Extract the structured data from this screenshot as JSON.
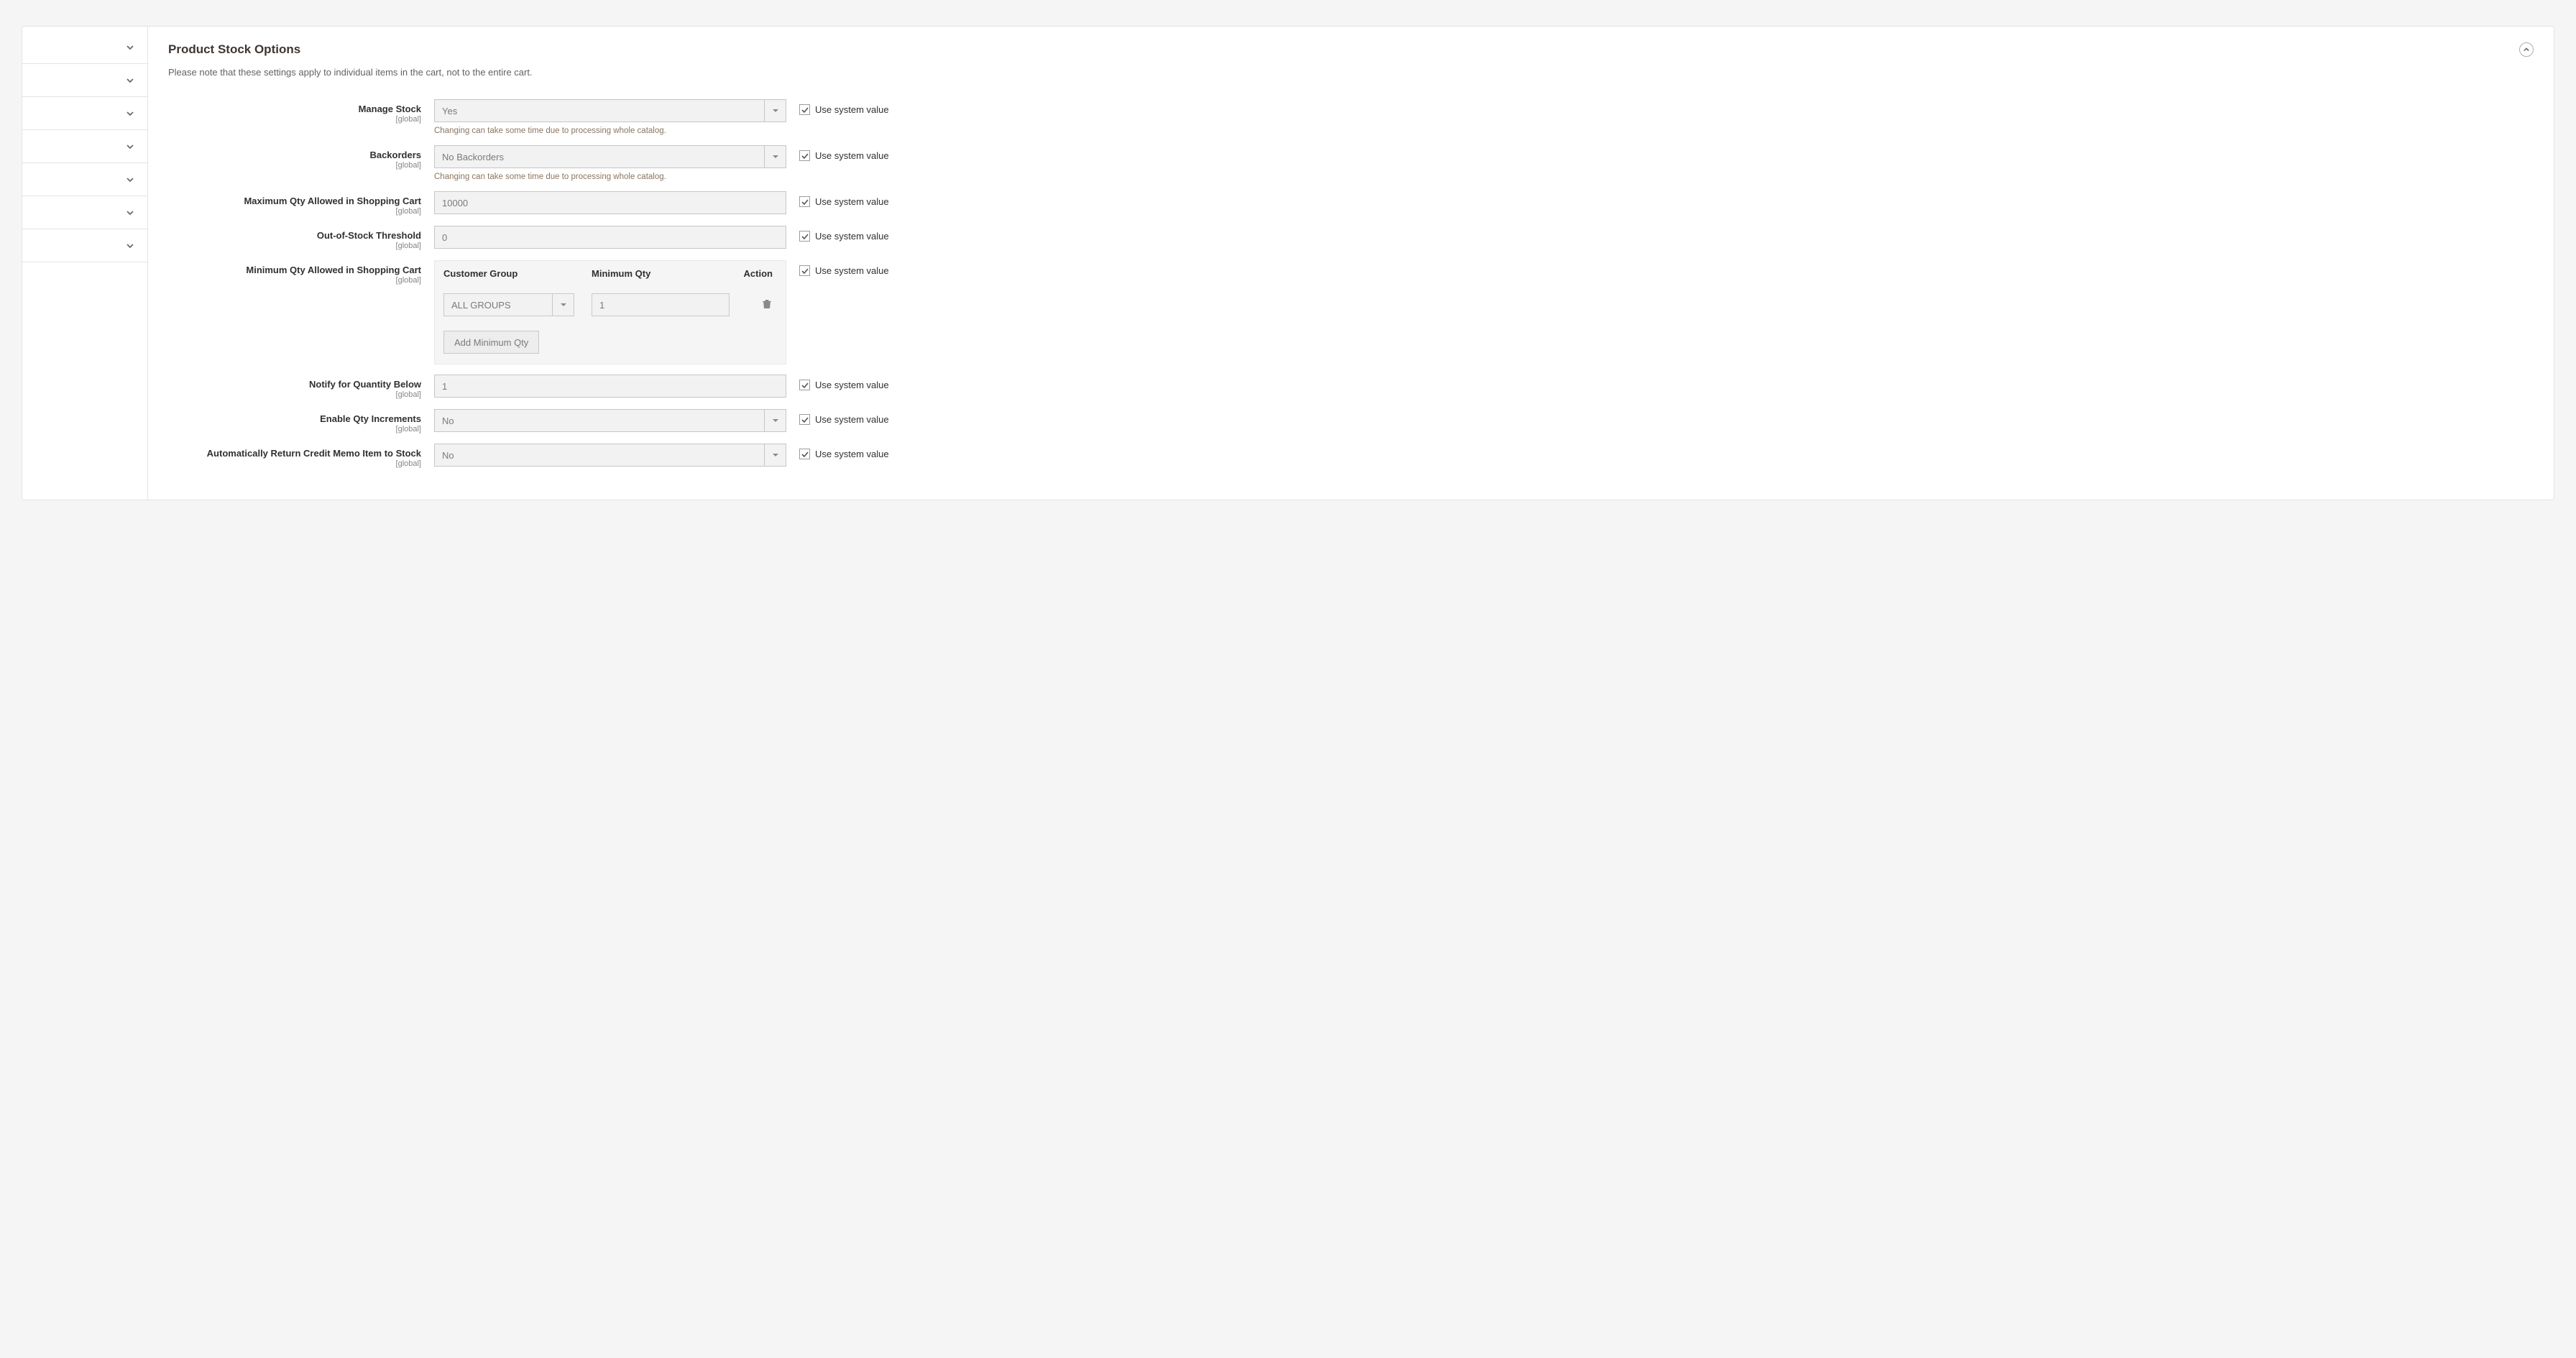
{
  "section": {
    "title": "Product Stock Options",
    "note": "Please note that these settings apply to individual items in the cart, not to the entire cart."
  },
  "scope_label": "[global]",
  "system_value_label": "Use system value",
  "fields": {
    "manage_stock": {
      "label": "Manage Stock",
      "value": "Yes",
      "hint": "Changing can take some time due to processing whole catalog."
    },
    "backorders": {
      "label": "Backorders",
      "value": "No Backorders",
      "hint": "Changing can take some time due to processing whole catalog."
    },
    "max_qty": {
      "label": "Maximum Qty Allowed in Shopping Cart",
      "value": "10000"
    },
    "oos_threshold": {
      "label": "Out-of-Stock Threshold",
      "value": "0"
    },
    "min_qty": {
      "label": "Minimum Qty Allowed in Shopping Cart",
      "columns": {
        "group": "Customer Group",
        "qty": "Minimum Qty",
        "action": "Action"
      },
      "row": {
        "group": "ALL GROUPS",
        "qty": "1"
      },
      "add_button": "Add Minimum Qty"
    },
    "notify_below": {
      "label": "Notify for Quantity Below",
      "value": "1"
    },
    "qty_increments": {
      "label": "Enable Qty Increments",
      "value": "No"
    },
    "auto_return": {
      "label": "Automatically Return Credit Memo Item to Stock",
      "value": "No"
    }
  }
}
